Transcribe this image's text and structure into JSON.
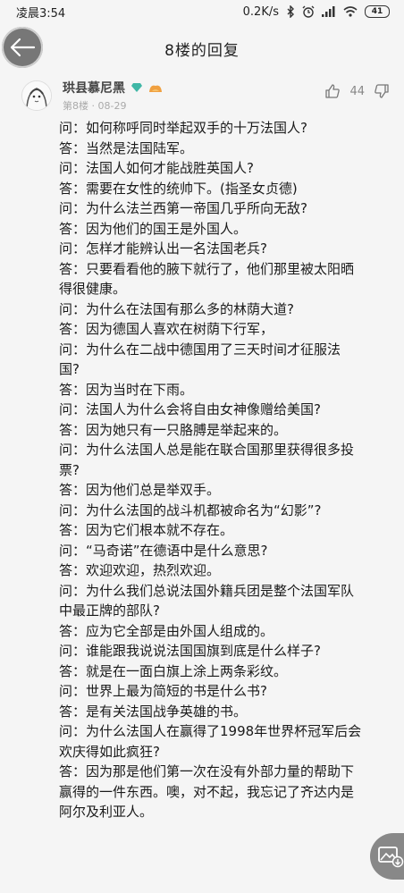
{
  "status_bar": {
    "time": "凌晨3:54",
    "network_speed": "0.2K/s",
    "battery": "41"
  },
  "nav": {
    "title": "8楼的回复"
  },
  "post": {
    "username": "珙县慕尼黑",
    "floor": "第8楼",
    "date": "08-29",
    "like_count": "44",
    "lines": [
      "问：如何称呼同时举起双手的十万法国人?",
      "答：当然是法国陆军。",
      "问：法国人如何才能战胜英国人?",
      "答：需要在女性的统帅下。(指圣女贞德)",
      "问：为什么法兰西第一帝国几乎所向无敌?",
      "答：因为他们的国王是外国人。",
      "问：怎样才能辨认出一名法国老兵?",
      "答：只要看看他的腋下就行了，他们那里被太阳晒",
      "得很健康。",
      "问：为什么在法国有那么多的林荫大道?",
      "答：因为德国人喜欢在树荫下行军，",
      "问：为什么在二战中德国用了三天时间才征服法",
      "国?",
      "答：因为当时在下雨。",
      "问：法国人为什么会将自由女神像赠给美国?",
      "答：因为她只有一只胳膊是举起来的。",
      "问：为什么法国人总是能在联合国那里获得很多投",
      "票?",
      "答：因为他们总是举双手。",
      "问：为什么法国的战斗机都被命名为“幻影”?",
      "答：因为它们根本就不存在。",
      "问：“马奇诺”在德语中是什么意思?",
      "答：欢迎欢迎，热烈欢迎。",
      "问：为什么我们总说法国外籍兵团是整个法国军队",
      "中最正牌的部队?",
      "答：应为它全部是由外国人组成的。",
      "问：谁能跟我说说法国国旗到底是什么样子?",
      "答：就是在一面白旗上涂上两条彩纹。",
      "问：世界上最为简短的书是什么书?",
      "答：是有关法国战争英雄的书。",
      "问：为什么法国人在赢得了1998年世界杯冠军后会",
      "欢庆得如此疯狂?",
      "答：因为那是他们第一次在没有外部力量的帮助下",
      "赢得的一件东西。噢，对不起，我忘记了齐达内是",
      "阿尔及利亚人。"
    ]
  },
  "colors": {
    "background": "#f5f5f5",
    "vip_badge": "#3fb7a6",
    "fan_badge": "#f0a040"
  }
}
